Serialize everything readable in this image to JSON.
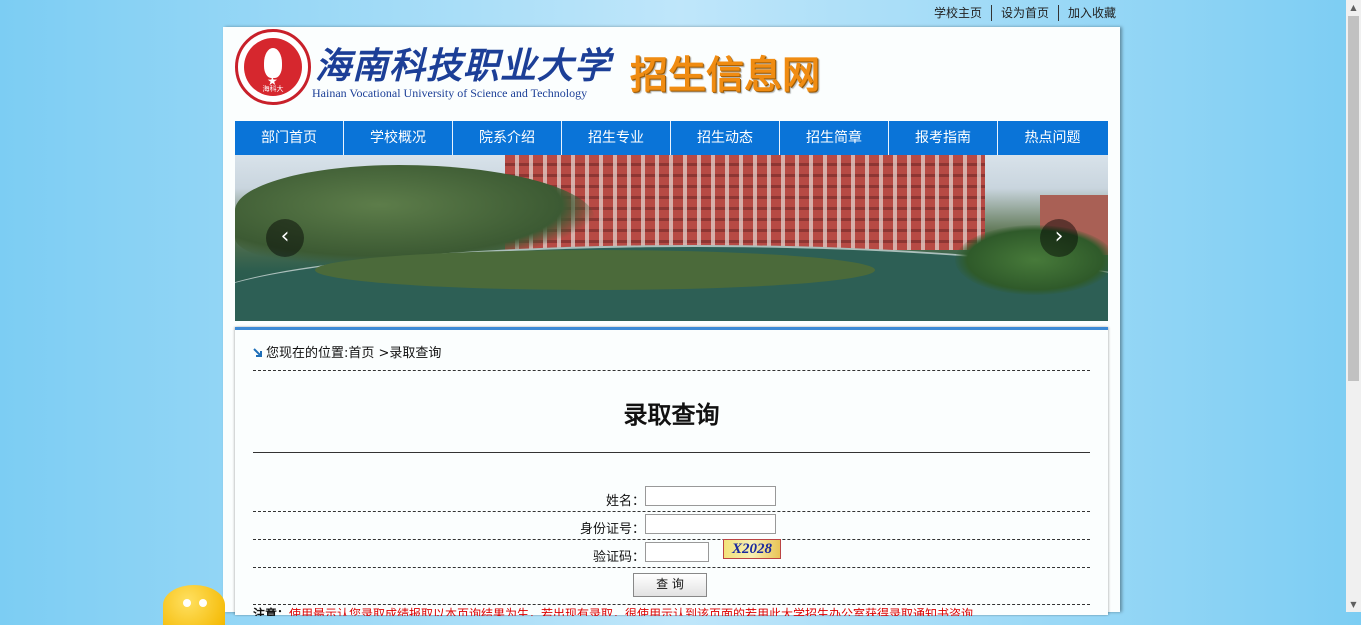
{
  "top_links": [
    "学校主页",
    "设为首页",
    "加入收藏"
  ],
  "header": {
    "logo_text": "海科大",
    "school_name_cn": "海南科技职业大学",
    "school_name_en": "Hainan Vocational University of Science and Technology",
    "site_name": "招生信息网"
  },
  "nav": {
    "items": [
      "部门首页",
      "学校概况",
      "院系介绍",
      "招生专业",
      "招生动态",
      "招生简章",
      "报考指南",
      "热点问题"
    ]
  },
  "banner": {
    "prev_label": "‹",
    "next_label": "›"
  },
  "breadcrumb": "您现在的位置:首页 >录取查询",
  "page_title": "录取查询",
  "form": {
    "name_label": "姓名：",
    "name_value": "",
    "id_label": "身份证号：",
    "id_value": "",
    "captcha_label": "验证码：",
    "captcha_value": "",
    "captcha_image_text": "X2028",
    "submit_label": "查 询"
  },
  "notice": {
    "prefix": "注意：",
    "text": "使用最示认您录取成绩报取以本页询结果为生，若出现有录取，很使用示认到该页面的若用此大学招生办公室获得录取通知书咨询"
  },
  "colors": {
    "nav_bg": "#0a74d8",
    "site_name": "#f08c12",
    "school_name": "#1c3f97"
  }
}
